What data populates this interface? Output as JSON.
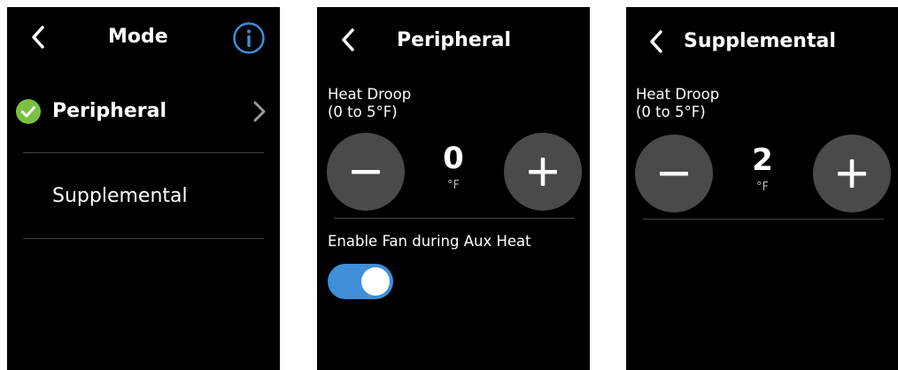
{
  "colors": {
    "accent": "#3f8ed8",
    "check_green": "#7ac143",
    "button_gray": "#4a4a4a",
    "background": "#000000"
  },
  "screen_mode": {
    "title": "Mode",
    "back_icon": "chevron-left-icon",
    "info_icon": "info-circle-icon",
    "items": [
      {
        "label": "Peripheral",
        "selected": true,
        "icon": "check-circle-icon",
        "trailing_icon": "chevron-right-icon"
      },
      {
        "label": "Supplemental",
        "selected": false
      }
    ]
  },
  "screen_peripheral": {
    "title": "Peripheral",
    "heat_droop_label": "Heat Droop",
    "heat_droop_range": "(0 to 5°F)",
    "value": "0",
    "unit": "°F",
    "fan_label": "Enable Fan during Aux Heat",
    "fan_enabled": true
  },
  "screen_supplemental": {
    "title": "Supplemental",
    "heat_droop_label": "Heat Droop",
    "heat_droop_range": "(0 to 5°F)",
    "value": "2",
    "unit": "°F"
  }
}
